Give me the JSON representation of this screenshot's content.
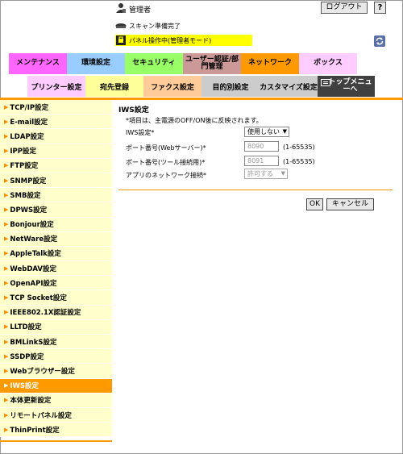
{
  "header": {
    "admin_label": "管理者",
    "logout_label": "ログアウト",
    "help_label": "?",
    "scan_status": "スキャン準備完了",
    "panel_mode": "パネル操作中(管理者モード)"
  },
  "tabs_row1": [
    {
      "label": "メンテナンス",
      "bg": "#ff66ff"
    },
    {
      "label": "環境設定",
      "bg": "#99ccff"
    },
    {
      "label": "セキュリティ",
      "bg": "#99ff66"
    },
    {
      "label": "ユーザー認証/部門管理",
      "bg": "#cc9999"
    },
    {
      "label": "ネットワーク",
      "bg": "#ff9900"
    },
    {
      "label": "ボックス",
      "bg": "#ffccff"
    }
  ],
  "tabs_row2": [
    {
      "label": "プリンター設定",
      "bg": "#ffccff"
    },
    {
      "label": "宛先登録",
      "bg": "#ffff99"
    },
    {
      "label": "ファクス設定",
      "bg": "#ffcc99"
    },
    {
      "label": "目的別設定",
      "bg": "#cccccc"
    },
    {
      "label": "カスタマイズ設定",
      "bg": "#cccccc"
    },
    {
      "label": "トップメニューへ",
      "bg": "#404040"
    }
  ],
  "sidebar": {
    "items": [
      "TCP/IP設定",
      "E-mail設定",
      "LDAP設定",
      "IPP設定",
      "FTP設定",
      "SNMP設定",
      "SMB設定",
      "DPWS設定",
      "Bonjour設定",
      "NetWare設定",
      "AppleTalk設定",
      "WebDAV設定",
      "OpenAPI設定",
      "TCP Socket設定",
      "IEEE802.1X認証設定",
      "LLTD設定",
      "BMLinkS設定",
      "SSDP設定",
      "Webブラウザー設定",
      "IWS設定",
      "本体更新設定",
      "リモートパネル設定",
      "ThinPrint設定"
    ],
    "active_index": 19
  },
  "form": {
    "title": "IWS設定",
    "note": "*項目は、主電源のOFF/ON後に反映されます。",
    "iws_label": "IWS設定*",
    "iws_value": "使用しない",
    "web_port_label": "ポート番号(Webサーバー)*",
    "web_port_value": "8090",
    "web_port_range": "(1-65535)",
    "tool_port_label": "ポート番号(ツール接続用)*",
    "tool_port_value": "8091",
    "tool_port_range": "(1-65535)",
    "network_label": "アプリのネットワーク接続*",
    "network_value": "許可する",
    "ok_label": "OK",
    "cancel_label": "キャンセル"
  },
  "colors": {
    "accent": "#ff9900",
    "sidebar_bg": "#ffffcc",
    "mode_bar": "#ffff00"
  }
}
